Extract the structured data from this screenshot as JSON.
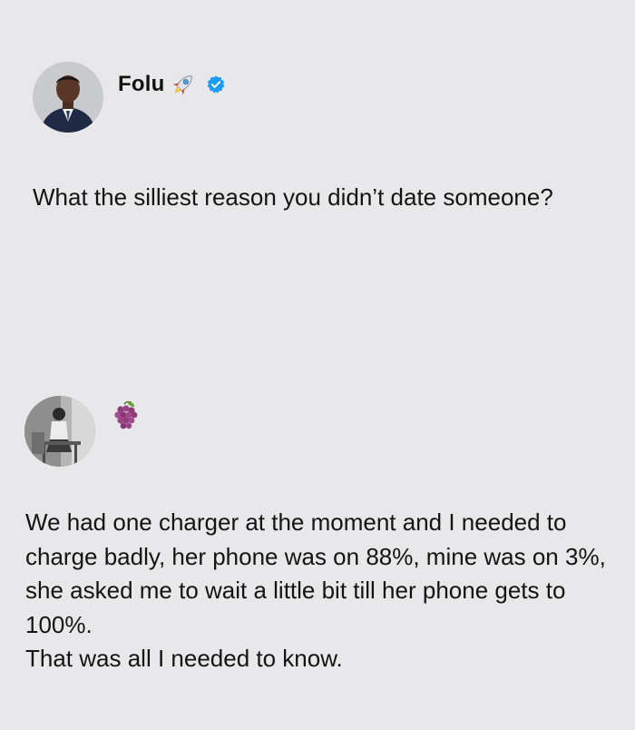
{
  "post1": {
    "author_name": "Folu",
    "author_emoji": "rocket-icon",
    "verified_badge": "verified-badge-icon",
    "text": "What the silliest reason you didn’t date someone?"
  },
  "post2": {
    "author_emoji": "grapes-icon",
    "text_lines": [
      "We had one charger at the moment and I needed to charge badly, her phone was on 88%, mine was on 3%, she asked me to wait a little bit till her phone gets to 100%.",
      "That was all I needed to know."
    ]
  },
  "colors": {
    "background": "#e8e8ea",
    "verified_blue": "#1d9bf0",
    "text": "#141414"
  }
}
